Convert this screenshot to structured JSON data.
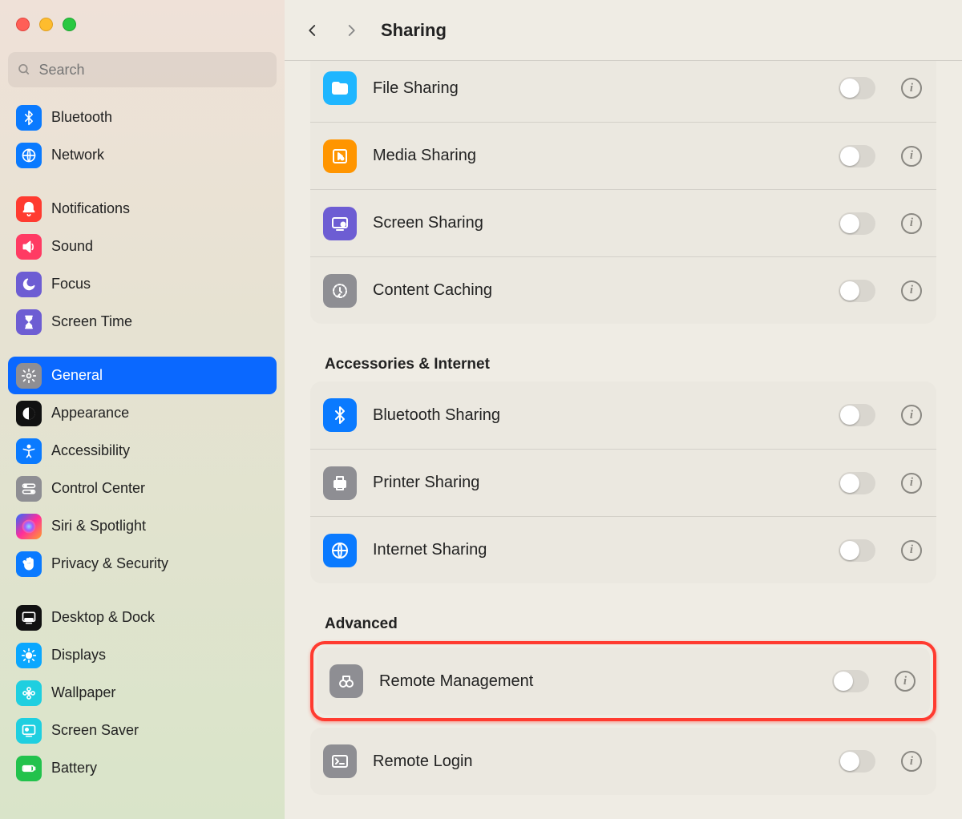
{
  "header": {
    "title": "Sharing"
  },
  "search": {
    "placeholder": "Search"
  },
  "sidebar": {
    "items": [
      {
        "label": "Bluetooth",
        "icon": "bluetooth",
        "bg": "#0a7aff"
      },
      {
        "label": "Network",
        "icon": "globe",
        "bg": "#0a7aff"
      },
      {
        "gap": true
      },
      {
        "label": "Notifications",
        "icon": "bell",
        "bg": "#ff3b30"
      },
      {
        "label": "Sound",
        "icon": "speaker",
        "bg": "#ff3b63"
      },
      {
        "label": "Focus",
        "icon": "moon",
        "bg": "#6d5dd3"
      },
      {
        "label": "Screen Time",
        "icon": "hourglass",
        "bg": "#6d5dd3"
      },
      {
        "gap": true
      },
      {
        "label": "General",
        "icon": "gear",
        "bg": "#8e8e93",
        "selected": true
      },
      {
        "label": "Appearance",
        "icon": "appearance",
        "bg": "#111"
      },
      {
        "label": "Accessibility",
        "icon": "accessibility",
        "bg": "#0a7aff"
      },
      {
        "label": "Control Center",
        "icon": "switches",
        "bg": "#8e8e93"
      },
      {
        "label": "Siri & Spotlight",
        "icon": "siri",
        "bg": "linear-gradient(135deg,#2b6cff,#ff2d9b,#ff9e2c)"
      },
      {
        "label": "Privacy & Security",
        "icon": "hand",
        "bg": "#0a7aff"
      },
      {
        "gap": true
      },
      {
        "label": "Desktop & Dock",
        "icon": "dock",
        "bg": "#111"
      },
      {
        "label": "Displays",
        "icon": "sun",
        "bg": "#0aa7ff"
      },
      {
        "label": "Wallpaper",
        "icon": "flower",
        "bg": "#1fcfe0"
      },
      {
        "label": "Screen Saver",
        "icon": "screensaver",
        "bg": "#1fcfe0"
      },
      {
        "label": "Battery",
        "icon": "battery",
        "bg": "#22c24c"
      }
    ]
  },
  "sections": [
    {
      "title": null,
      "rows": [
        {
          "label": "File Sharing",
          "icon": "folder",
          "bg": "#1fb6ff"
        },
        {
          "label": "Media Sharing",
          "icon": "media",
          "bg": "#ff9500"
        },
        {
          "label": "Screen Sharing",
          "icon": "screenshare",
          "bg": "#6d5dd3"
        },
        {
          "label": "Content Caching",
          "icon": "caching",
          "bg": "#8e8e93"
        }
      ]
    },
    {
      "title": "Accessories & Internet",
      "rows": [
        {
          "label": "Bluetooth Sharing",
          "icon": "bluetooth",
          "bg": "#0a7aff"
        },
        {
          "label": "Printer Sharing",
          "icon": "printer",
          "bg": "#8e8e93"
        },
        {
          "label": "Internet Sharing",
          "icon": "globe",
          "bg": "#0a7aff"
        }
      ]
    },
    {
      "title": "Advanced",
      "highlighted_row": 0,
      "rows": [
        {
          "label": "Remote Management",
          "icon": "binoculars",
          "bg": "#8e8e93"
        },
        {
          "label": "Remote Login",
          "icon": "terminal",
          "bg": "#8e8e93"
        }
      ]
    }
  ]
}
